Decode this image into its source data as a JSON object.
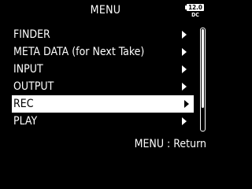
{
  "header": {
    "title": "MENU",
    "battery": {
      "voltage": "12.0",
      "source": "DC"
    }
  },
  "menu": {
    "items": [
      {
        "label": "FINDER",
        "selected": false
      },
      {
        "label": "META DATA (for Next Take)",
        "selected": false
      },
      {
        "label": "INPUT",
        "selected": false
      },
      {
        "label": "OUTPUT",
        "selected": false
      },
      {
        "label": "REC",
        "selected": true
      },
      {
        "label": "PLAY",
        "selected": false
      }
    ]
  },
  "scrollbar": {
    "thumb_start": 0.0,
    "thumb_end": 0.78
  },
  "footer": {
    "hint": "MENU : Return"
  },
  "colors": {
    "background": "#000000",
    "text": "#ffffff",
    "selection": "#ffffff"
  }
}
